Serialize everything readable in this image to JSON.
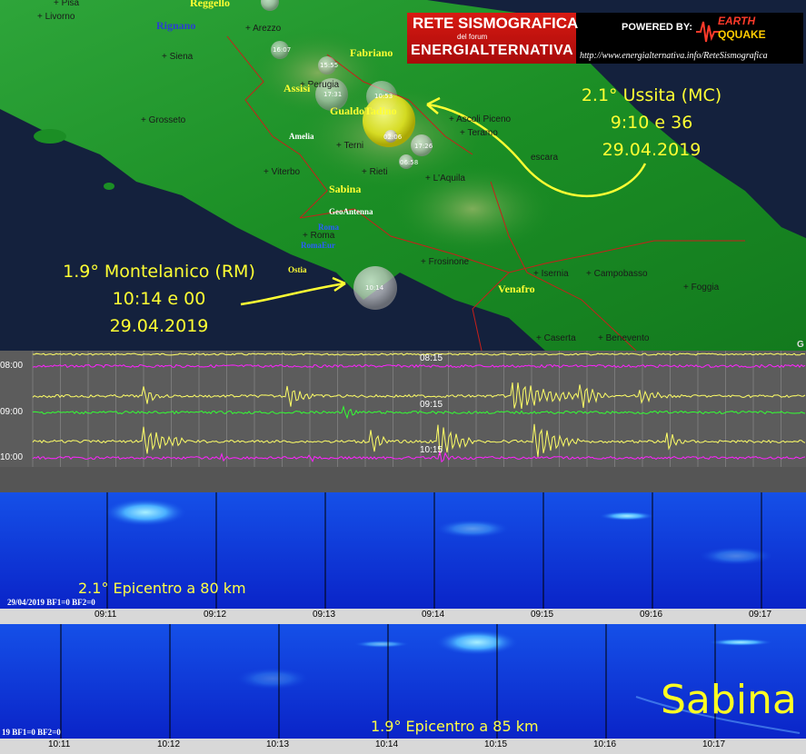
{
  "logo": {
    "line1": "RETE SISMOGRAFICA",
    "line2": "del forum",
    "line3": "ENERGIALTERNATIVA",
    "powered": "POWERED BY:",
    "brand_top": "EARTH",
    "brand_bottom": "QQUAKE",
    "url": "http://www.energialternativa.info/ReteSismografica"
  },
  "map": {
    "cities": [
      {
        "name": "Pisa",
        "text": "+ Pisa"
      },
      {
        "name": "Livorno",
        "text": "+ Livorno"
      },
      {
        "name": "Arezzo",
        "text": "+ Arezzo"
      },
      {
        "name": "Siena",
        "text": "+ Siena"
      },
      {
        "name": "Perugia",
        "text": "+ Perugia"
      },
      {
        "name": "Grosseto",
        "text": "+ Grosseto"
      },
      {
        "name": "Terni",
        "text": "+ Terni"
      },
      {
        "name": "Viterbo",
        "text": "+ Viterbo"
      },
      {
        "name": "Rieti",
        "text": "+ Rieti"
      },
      {
        "name": "Ascoli",
        "text": "+ Ascoli Piceno"
      },
      {
        "name": "Teramo",
        "text": "+ Teramo"
      },
      {
        "name": "Pescara",
        "text": "escara"
      },
      {
        "name": "Aquila",
        "text": "+ L'Aquila"
      },
      {
        "name": "Roma",
        "text": "+ Roma"
      },
      {
        "name": "Frosinone",
        "text": "+ Frosinone"
      },
      {
        "name": "Isernia",
        "text": "+ Isernia"
      },
      {
        "name": "Campobasso",
        "text": "+ Campobasso"
      },
      {
        "name": "Foggia",
        "text": "+ Foggia"
      },
      {
        "name": "Caserta",
        "text": "+ Caserta"
      },
      {
        "name": "Benevento",
        "text": "+ Benevento"
      }
    ],
    "regions": {
      "reggello": "Reggello",
      "rignano": "Rignano",
      "fabriano": "Fabriano",
      "assisi": "Assisi",
      "gualdo": "GualdoTadino",
      "sabina": "Sabina",
      "venafro": "Venafro"
    },
    "stations": {
      "amelia": "Amelia",
      "geoantenna": "GeoAntenna",
      "roma": "Roma",
      "romaeur": "RomaEur",
      "ostia": "Ostia"
    },
    "quake_labels": {
      "q1": "16:07",
      "q2": "15:55",
      "q3": "17:31",
      "q4": "10:53",
      "q5": "02:06",
      "q6": "17:26",
      "q7": "06:58",
      "big": "10:14"
    },
    "annotation_ussita": [
      "2.1° Ussita (MC)",
      "9:10 e 36",
      "29.04.2019"
    ],
    "annotation_montelanico": [
      "1.9° Montelanico (RM)",
      "10:14 e 00",
      "29.04.2019"
    ],
    "corner_letter": "G"
  },
  "seismogram": {
    "hours": [
      "08:00",
      "09:00",
      "10:00"
    ],
    "marks": [
      "08:15",
      "09:15",
      "10:15"
    ]
  },
  "spectrogram1": {
    "title": "2.1° Epicentro a 80 km",
    "info": "29/04/2019 BF1=0 BF2=0",
    "ticks": [
      "09:11",
      "09:12",
      "09:13",
      "09:14",
      "09:15",
      "09:16",
      "09:17"
    ]
  },
  "spectrogram2": {
    "title": "1.9° Epicentro a 85 km",
    "info": "19 BF1=0 BF2=0",
    "station": "Sabina",
    "ticks": [
      "10:11",
      "10:12",
      "10:13",
      "10:14",
      "10:15",
      "10:16",
      "10:17"
    ]
  },
  "colors": {
    "annotation": "#ffff33",
    "land": "#1f9a2a",
    "sea": "#14213d",
    "trace_yellow": "#ffff66",
    "trace_magenta": "#ff22ff",
    "trace_green": "#33ff33",
    "spectrogram_bg": "#0a2fd8"
  }
}
